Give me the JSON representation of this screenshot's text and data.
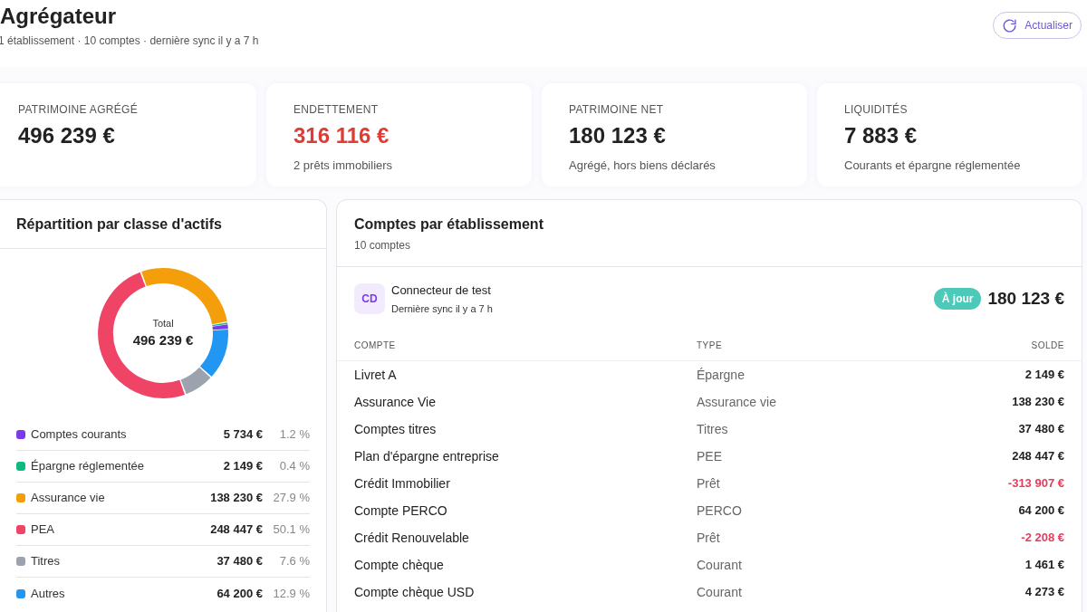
{
  "header": {
    "title": "Agrégateur",
    "subtitle": "1 établissement · 10 comptes · dernière sync il y a 7 h",
    "refresh_button": "Actualiser"
  },
  "kpis": [
    {
      "label": "PATRIMOINE AGRÉGÉ",
      "value": "496 239 €",
      "negative": false
    },
    {
      "label": "ENDETTEMENT",
      "value": "316 116 €",
      "negative": true,
      "note": "2 prêts immobiliers"
    },
    {
      "label": "PATRIMOINE NET",
      "value": "180 123 €",
      "negative": false,
      "note": "Agrégé, hors biens déclarés"
    },
    {
      "label": "LIQUIDITÉS",
      "value": "7 883 €",
      "negative": false,
      "note": "Courants et épargne réglementée"
    }
  ],
  "allocation": {
    "title": "Répartition par classe d'actifs",
    "center_label": "Total",
    "center_value": "496 239 €",
    "chart_data": {
      "type": "donut",
      "categories": [
        "Comptes courants",
        "Épargne réglementée",
        "Assurance vie",
        "PEA",
        "Titres",
        "Autres"
      ],
      "series": [
        {
          "values": [
            1.2,
            0.4,
            27.9,
            50.1,
            7.6,
            12.9
          ]
        }
      ]
    },
    "legend": [
      {
        "amount": "5 734 €",
        "share": "1.2 %",
        "color": "#7c3aed"
      },
      {
        "amount": "2 149 €",
        "share": "0.4 %",
        "color": "#10b981"
      },
      {
        "amount": "138 230 €",
        "share": "27.9 %",
        "color": "#f59e0b"
      },
      {
        "amount": "248 447 €",
        "share": "50.1 %",
        "color": "#ef4466"
      },
      {
        "amount": "37 480 €",
        "share": "7.6 %",
        "color": "#9ca3af"
      },
      {
        "amount": "64 200 €",
        "share": "12.9 %",
        "color": "#2196f3"
      }
    ]
  },
  "accounts": {
    "title": "Comptes par établissement",
    "subtitle": "10 comptes",
    "institution": {
      "initials": "CD",
      "name": "Connecteur de test",
      "sync": "Dernière sync il y a 7 h",
      "status": "À jour",
      "total": "180 123 €"
    },
    "columns": [
      "COMPTE",
      "TYPE",
      "SOLDE"
    ],
    "rows": [
      {
        "name": "Livret A",
        "type": "Épargne",
        "balance": "2 149 €",
        "negative": false
      },
      {
        "name": "Assurance Vie",
        "type": "Assurance vie",
        "balance": "138 230 €",
        "negative": false
      },
      {
        "name": "Comptes titres",
        "type": "Titres",
        "balance": "37 480 €",
        "negative": false
      },
      {
        "name": "Plan d'épargne entreprise",
        "type": "PEE",
        "balance": "248 447 €",
        "negative": false
      },
      {
        "name": "Crédit Immobilier",
        "type": "Prêt",
        "balance": "-313 907 €",
        "negative": true
      },
      {
        "name": "Compte PERCO",
        "type": "PERCO",
        "balance": "64 200 €",
        "negative": false
      },
      {
        "name": "Crédit Renouvelable",
        "type": "Prêt",
        "balance": "-2 208 €",
        "negative": true
      },
      {
        "name": "Compte chèque",
        "type": "Courant",
        "balance": "1 461 €",
        "negative": false
      },
      {
        "name": "Compte chèque USD",
        "type": "Courant",
        "balance": "4 273 €",
        "negative": false
      }
    ]
  }
}
